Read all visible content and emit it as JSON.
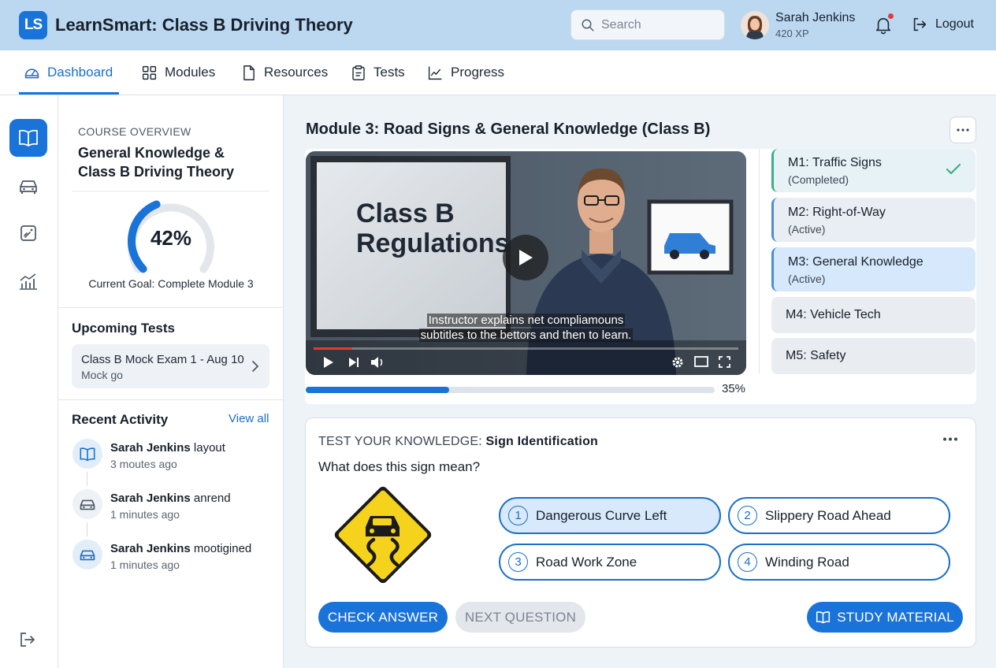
{
  "app": {
    "logo": "LS",
    "title": "LearnSmart: Class B Driving Theory"
  },
  "search": {
    "placeholder": "Search"
  },
  "user": {
    "name": "Sarah Jenkins",
    "xp": "420 XP",
    "logout": "Logout"
  },
  "colors": {
    "accent": "#1a73d9",
    "topbar": "#bcd8f1",
    "success": "#3fae84",
    "notification": "#e23a3a",
    "sign_yellow": "#f5d21c"
  },
  "nav": {
    "items": [
      {
        "label": "Dashboard",
        "icon": "gauge-icon",
        "active": true
      },
      {
        "label": "Modules",
        "icon": "grid-icon"
      },
      {
        "label": "Resources",
        "icon": "document-icon"
      },
      {
        "label": "Tests",
        "icon": "clipboard-icon"
      },
      {
        "label": "Progress",
        "icon": "line-chart-icon"
      }
    ]
  },
  "rail": {
    "icons": [
      "book-icon",
      "car-icon",
      "quiz-icon",
      "bar-chart-icon",
      "logout-icon"
    ]
  },
  "overview": {
    "label": "COURSE OVERVIEW",
    "title": "General Knowledge & Class B Driving Theory",
    "progress_percent": 42,
    "progress_label": "42%",
    "goal": "Current Goal: Complete Module 3"
  },
  "upcoming": {
    "title": "Upcoming Tests",
    "tests": [
      {
        "title": "Class B Mock Exam 1 - Aug 10",
        "subtitle": "Mock go"
      }
    ]
  },
  "activity": {
    "title": "Recent Activity",
    "view_all": "View all",
    "items": [
      {
        "name": "Sarah Jenkins",
        "action": "layout",
        "time": "3 moutes ago",
        "icon": "book-icon"
      },
      {
        "name": "Sarah Jenkins",
        "action": "anrend",
        "time": "1 minutes ago",
        "icon": "car-icon"
      },
      {
        "name": "Sarah Jenkins",
        "action": "mootigined",
        "time": "1 minutes ago",
        "icon": "car-icon"
      }
    ]
  },
  "module": {
    "title": "Module 3: Road Signs & General Knowledge (Class B)",
    "video": {
      "board_line1": "Class B",
      "board_line2": "Regulations",
      "caption_line1": "Instructor explains net compliamouns",
      "caption_line2": "subtitles to the bettors and then to learn.",
      "played_fraction": 0.09
    },
    "progress_percent": 35,
    "progress_label": "35%",
    "list": [
      {
        "title": "M1: Traffic Signs",
        "status": "(Completed)",
        "state": "done"
      },
      {
        "title": "M2: Right-of-Way",
        "status": "(Active)",
        "state": "active"
      },
      {
        "title": "M3: General Knowledge",
        "status": "(Active)",
        "state": "current"
      },
      {
        "title": "M4: Vehicle Tech",
        "status": "",
        "state": "locked"
      },
      {
        "title": "M5: Safety",
        "status": "",
        "state": "locked"
      }
    ]
  },
  "quiz": {
    "prefix": "TEST YOUR KNOWLEDGE:",
    "topic": "Sign Identification",
    "question": "What does this sign mean?",
    "options": [
      {
        "num": "1",
        "label": "Dangerous Curve Left",
        "selected": true
      },
      {
        "num": "2",
        "label": "Slippery Road Ahead"
      },
      {
        "num": "3",
        "label": "Road Work Zone"
      },
      {
        "num": "4",
        "label": "Winding Road"
      }
    ],
    "check": "CHECK ANSWER",
    "next": "NEXT QUESTION",
    "study": "STUDY MATERIAL"
  }
}
